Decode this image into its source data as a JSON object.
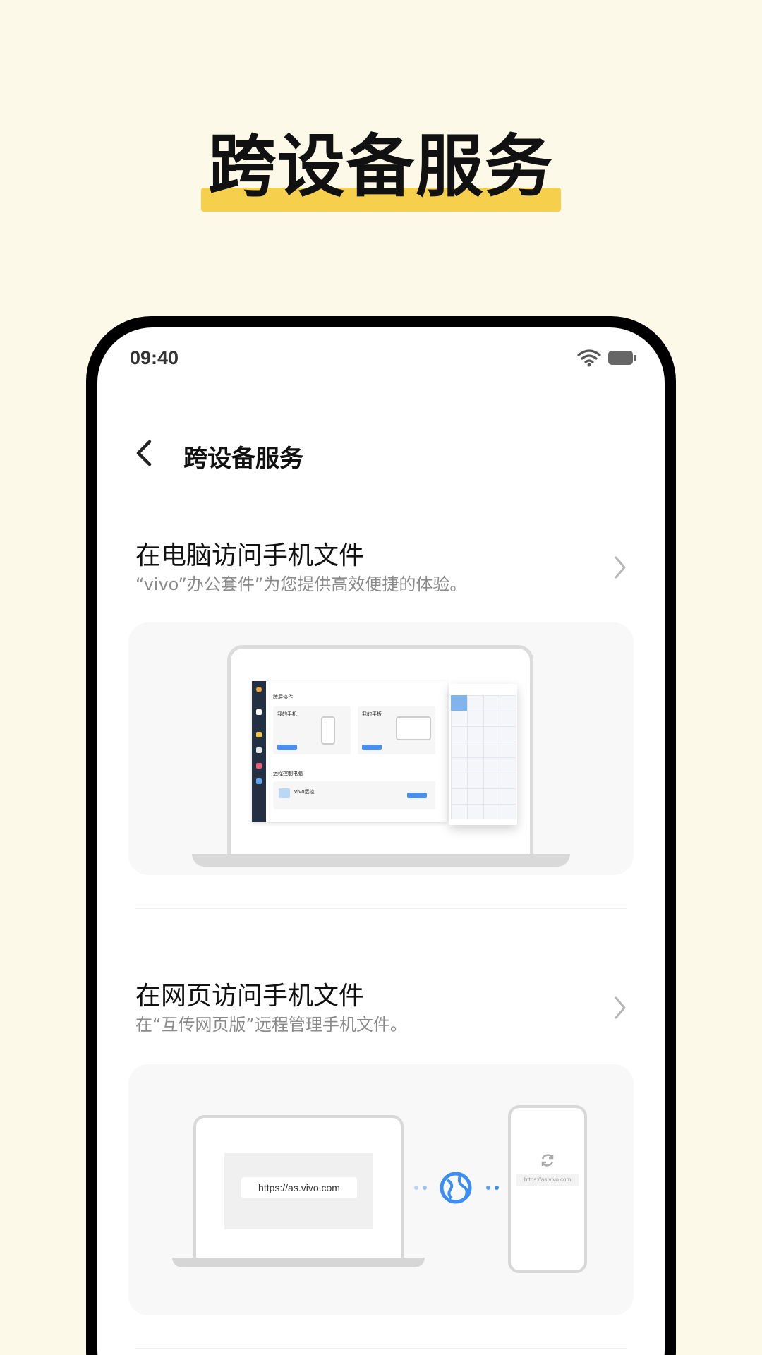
{
  "promo": {
    "title": "跨设备服务"
  },
  "status_bar": {
    "time": "09:40"
  },
  "header": {
    "title": "跨设备服务"
  },
  "sections": [
    {
      "title": "在电脑访问手机文件",
      "subtitle": "“vivo”办公套件”为您提供高效便捷的体验。"
    },
    {
      "title": "在网页访问手机文件",
      "subtitle": "在“互传网页版”远程管理手机文件。"
    }
  ],
  "illustration1": {
    "app_heading": "跨屏协作",
    "phone_label": "我的手机",
    "tablet_label": "我的平板",
    "remote_heading": "远程控制电脑",
    "remote_app": "vivo远控"
  },
  "illustration2": {
    "laptop_url": "https://as.vivo.com",
    "phone_url": "https://as.vivo.com"
  },
  "colors": {
    "background": "#fdf9e8",
    "highlight": "#f6d04d",
    "accent": "#3d8ef2"
  }
}
